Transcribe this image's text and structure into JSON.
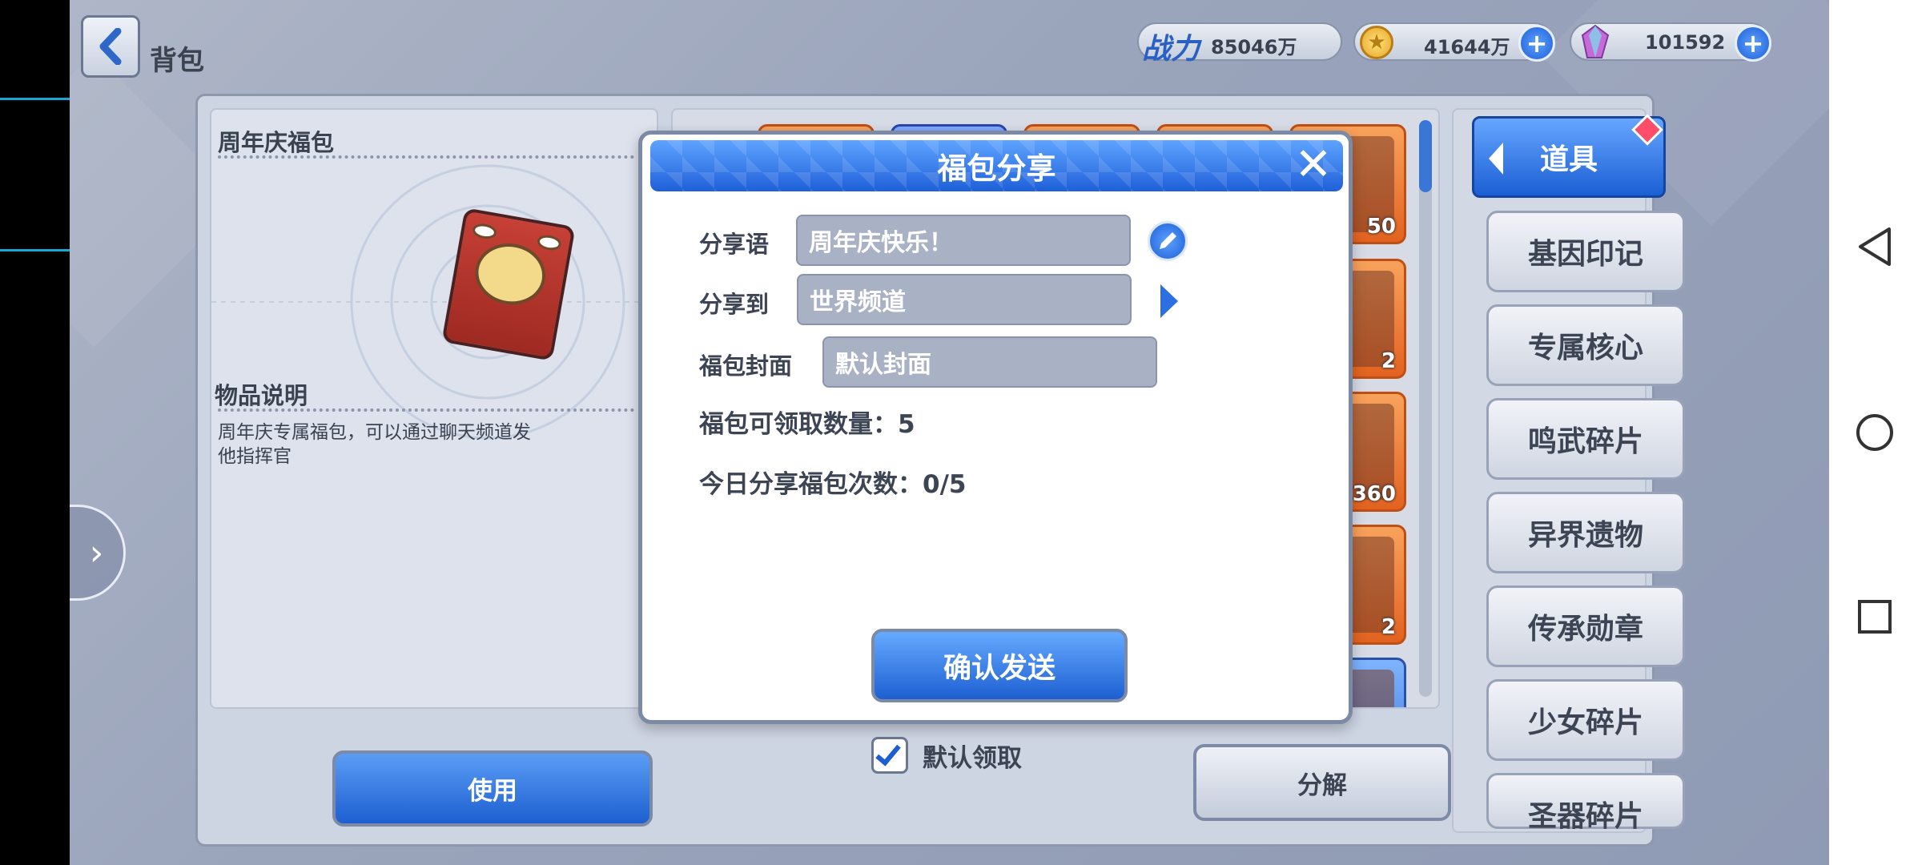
{
  "header": {
    "title": "背包",
    "power_label": "战力",
    "power_value": "85046万",
    "gold_value": "41644万",
    "crystal_value": "101592"
  },
  "item": {
    "name": "周年庆福包",
    "desc_title": "物品说明",
    "desc_line1": "周年庆专属福包，可以通过聊天频道发",
    "desc_line2": "他指挥官"
  },
  "grid": {
    "counts": [
      "50",
      "2",
      "360",
      "2"
    ]
  },
  "categories": {
    "active": "道具",
    "items": [
      "基因印记",
      "专属核心",
      "鸣武碎片",
      "异界遗物",
      "传承勋章",
      "少女碎片",
      "圣器碎片"
    ]
  },
  "buttons": {
    "use": "使用",
    "split": "分解",
    "default_claim": "默认领取"
  },
  "dialog": {
    "title": "福包分享",
    "close": "✕",
    "share_words_label": "分享语",
    "share_words_value": "周年庆快乐！",
    "share_to_label": "分享到",
    "share_to_value": "世界频道",
    "cover_label": "福包封面",
    "cover_value": "默认封面",
    "claim_count": "福包可领取数量：5",
    "today_count": "今日分享福包次数：0/5",
    "confirm": "确认发送"
  }
}
